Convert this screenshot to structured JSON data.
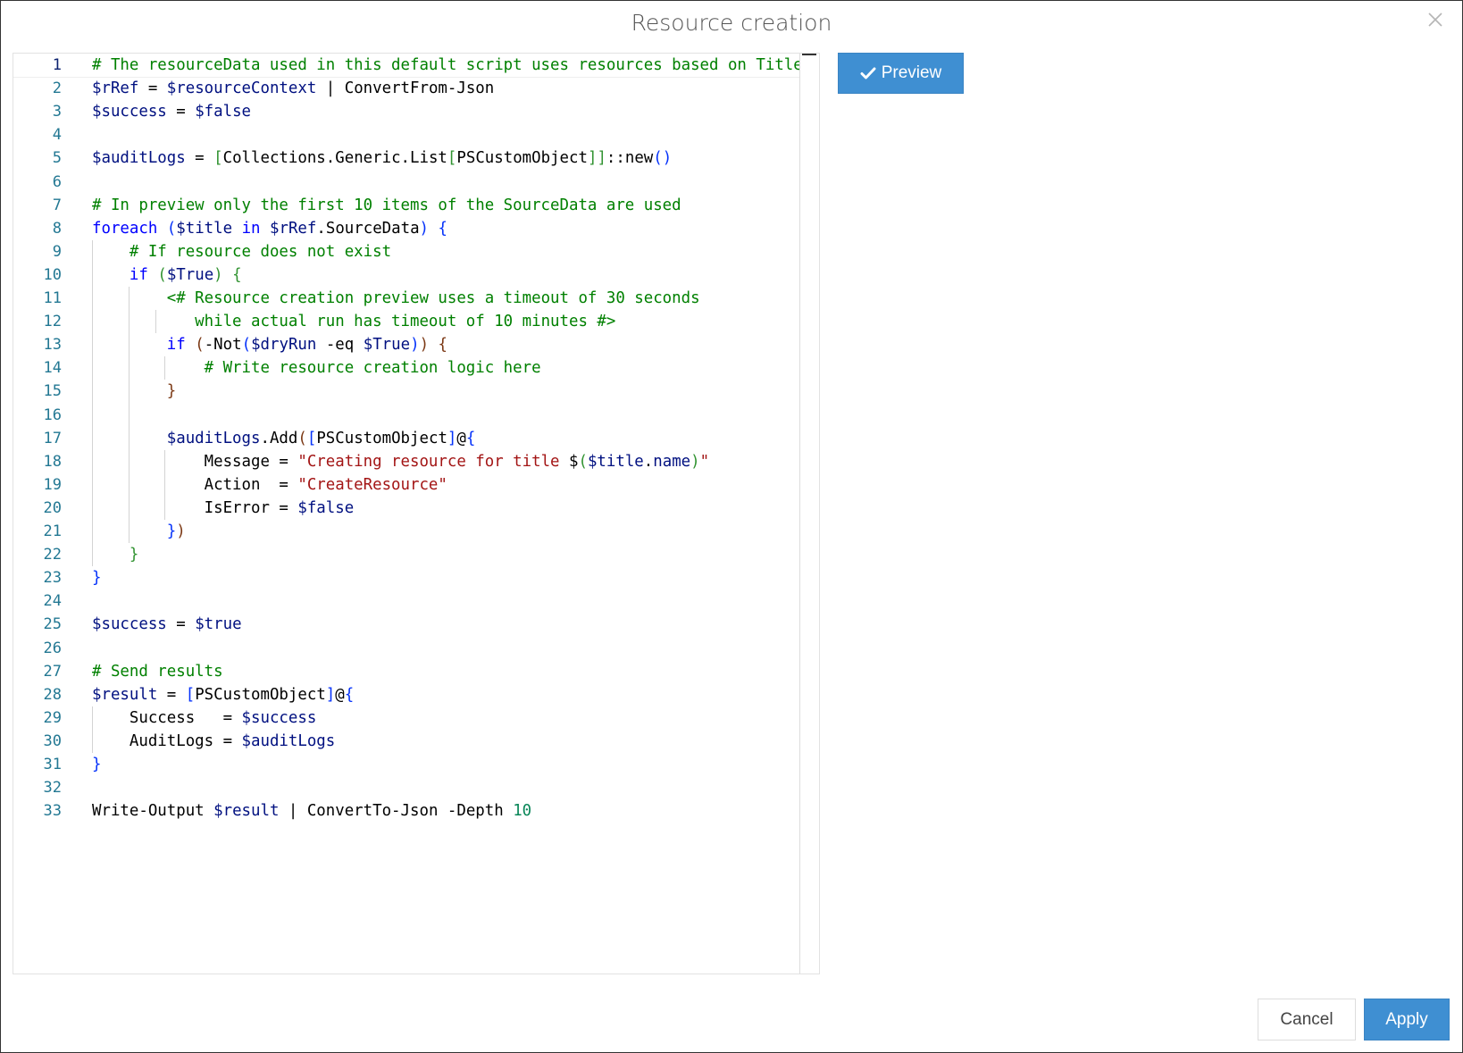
{
  "dialog": {
    "title": "Resource creation",
    "close_icon": "close-icon"
  },
  "toolbar": {
    "preview_label": "Preview",
    "preview_icon": "checkmark-icon"
  },
  "footer": {
    "cancel_label": "Cancel",
    "apply_label": "Apply"
  },
  "colors": {
    "primary": "#3f8fd2",
    "comment": "#008000",
    "variable": "#001080",
    "keyword": "#0000ff",
    "string": "#a31515",
    "number": "#098658",
    "line_number": "#237893"
  },
  "editor": {
    "active_line": 1,
    "lines": [
      {
        "n": "1",
        "t": [
          [
            "c",
            "# The resourceData used in this default script uses resources based on Title"
          ]
        ]
      },
      {
        "n": "2",
        "t": [
          [
            "v",
            "$rRef"
          ],
          [
            "",
            " = "
          ],
          [
            "v",
            "$resourceContext"
          ],
          [
            "",
            " | ConvertFrom-Json"
          ]
        ]
      },
      {
        "n": "3",
        "t": [
          [
            "v",
            "$success"
          ],
          [
            "",
            " = "
          ],
          [
            "v",
            "$false"
          ]
        ]
      },
      {
        "n": "4",
        "t": []
      },
      {
        "n": "5",
        "t": [
          [
            "v",
            "$auditLogs"
          ],
          [
            "",
            " = "
          ],
          [
            "p2",
            "["
          ],
          [
            "",
            "Collections.Generic.List"
          ],
          [
            "p2",
            "["
          ],
          [
            "",
            "PSCustomObject"
          ],
          [
            "p2",
            "]]"
          ],
          [
            "",
            "::new"
          ],
          [
            "p",
            "()"
          ]
        ]
      },
      {
        "n": "6",
        "t": []
      },
      {
        "n": "7",
        "t": [
          [
            "c",
            "# In preview only the first 10 items of the SourceData are used"
          ]
        ]
      },
      {
        "n": "8",
        "t": [
          [
            "k",
            "foreach"
          ],
          [
            "",
            " "
          ],
          [
            "p",
            "("
          ],
          [
            "v",
            "$title"
          ],
          [
            "",
            " "
          ],
          [
            "k",
            "in"
          ],
          [
            "",
            " "
          ],
          [
            "v",
            "$rRef"
          ],
          [
            "",
            ".SourceData"
          ],
          [
            "p",
            ")"
          ],
          [
            "",
            " "
          ],
          [
            "p",
            "{"
          ]
        ]
      },
      {
        "n": "9",
        "t": [
          [
            "",
            "    "
          ],
          [
            "c",
            "# If resource does not exist"
          ]
        ]
      },
      {
        "n": "10",
        "t": [
          [
            "",
            "    "
          ],
          [
            "k",
            "if"
          ],
          [
            "",
            " "
          ],
          [
            "p2",
            "("
          ],
          [
            "v",
            "$True"
          ],
          [
            "p2",
            ")"
          ],
          [
            "",
            " "
          ],
          [
            "p2",
            "{"
          ]
        ]
      },
      {
        "n": "11",
        "t": [
          [
            "",
            "        "
          ],
          [
            "c",
            "<# Resource creation preview uses a timeout of 30 seconds"
          ]
        ]
      },
      {
        "n": "12",
        "t": [
          [
            "",
            "           "
          ],
          [
            "c",
            "while actual run has timeout of 10 minutes #>"
          ]
        ]
      },
      {
        "n": "13",
        "t": [
          [
            "",
            "        "
          ],
          [
            "k",
            "if"
          ],
          [
            "",
            " "
          ],
          [
            "p3",
            "("
          ],
          [
            "",
            "-Not"
          ],
          [
            "p",
            "("
          ],
          [
            "v",
            "$dryRun"
          ],
          [
            "",
            " -eq "
          ],
          [
            "v",
            "$True"
          ],
          [
            "p",
            ")"
          ],
          [
            "p3",
            ")"
          ],
          [
            "",
            " "
          ],
          [
            "p3",
            "{"
          ]
        ]
      },
      {
        "n": "14",
        "t": [
          [
            "",
            "            "
          ],
          [
            "c",
            "# Write resource creation logic here"
          ]
        ]
      },
      {
        "n": "15",
        "t": [
          [
            "",
            "        "
          ],
          [
            "p3",
            "}"
          ]
        ]
      },
      {
        "n": "16",
        "t": []
      },
      {
        "n": "17",
        "t": [
          [
            "",
            "        "
          ],
          [
            "v",
            "$auditLogs"
          ],
          [
            "",
            ".Add"
          ],
          [
            "p3",
            "("
          ],
          [
            "p",
            "["
          ],
          [
            "",
            "PSCustomObject"
          ],
          [
            "p",
            "]"
          ],
          [
            "",
            "@"
          ],
          [
            "p",
            "{"
          ]
        ]
      },
      {
        "n": "18",
        "t": [
          [
            "",
            "            Message = "
          ],
          [
            "s",
            "\"Creating resource for title "
          ],
          [
            "",
            "$"
          ],
          [
            "p2",
            "("
          ],
          [
            "v",
            "$title"
          ],
          [
            "",
            "."
          ],
          [
            "v",
            "name"
          ],
          [
            "p2",
            ")"
          ],
          [
            "s",
            "\""
          ]
        ]
      },
      {
        "n": "19",
        "t": [
          [
            "",
            "            Action  = "
          ],
          [
            "s",
            "\"CreateResource\""
          ]
        ]
      },
      {
        "n": "20",
        "t": [
          [
            "",
            "            IsError = "
          ],
          [
            "v",
            "$false"
          ]
        ]
      },
      {
        "n": "21",
        "t": [
          [
            "",
            "        "
          ],
          [
            "p",
            "}"
          ],
          [
            "p3",
            ")"
          ]
        ]
      },
      {
        "n": "22",
        "t": [
          [
            "",
            "    "
          ],
          [
            "p2",
            "}"
          ]
        ]
      },
      {
        "n": "23",
        "t": [
          [
            "p",
            "}"
          ]
        ]
      },
      {
        "n": "24",
        "t": []
      },
      {
        "n": "25",
        "t": [
          [
            "v",
            "$success"
          ],
          [
            "",
            " = "
          ],
          [
            "v",
            "$true"
          ]
        ]
      },
      {
        "n": "26",
        "t": []
      },
      {
        "n": "27",
        "t": [
          [
            "c",
            "# Send results"
          ]
        ]
      },
      {
        "n": "28",
        "t": [
          [
            "v",
            "$result"
          ],
          [
            "",
            " = "
          ],
          [
            "p",
            "["
          ],
          [
            "",
            "PSCustomObject"
          ],
          [
            "p",
            "]"
          ],
          [
            "",
            "@"
          ],
          [
            "p",
            "{"
          ]
        ]
      },
      {
        "n": "29",
        "t": [
          [
            "",
            "    Success   = "
          ],
          [
            "v",
            "$success"
          ]
        ]
      },
      {
        "n": "30",
        "t": [
          [
            "",
            "    AuditLogs = "
          ],
          [
            "v",
            "$auditLogs"
          ]
        ]
      },
      {
        "n": "31",
        "t": [
          [
            "p",
            "}"
          ]
        ]
      },
      {
        "n": "32",
        "t": []
      },
      {
        "n": "33",
        "t": [
          [
            "",
            "Write-Output "
          ],
          [
            "v",
            "$result"
          ],
          [
            "",
            " | ConvertTo-Json -Depth "
          ],
          [
            "n",
            "10"
          ]
        ]
      }
    ]
  }
}
